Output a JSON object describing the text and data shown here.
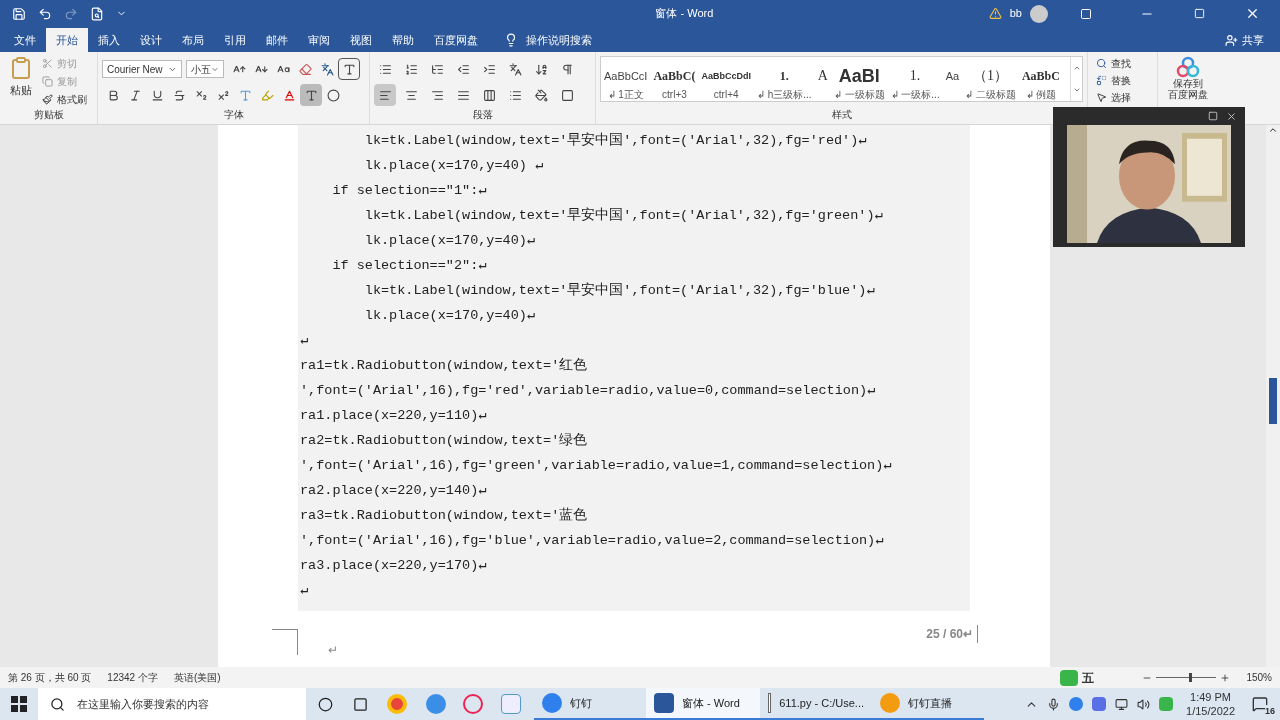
{
  "title_bar": {
    "title": "窗体  -  Word",
    "user": "bb"
  },
  "tabs": [
    {
      "label": "文件",
      "selected": false
    },
    {
      "label": "开始",
      "selected": true
    },
    {
      "label": "插入",
      "selected": false
    },
    {
      "label": "设计",
      "selected": false
    },
    {
      "label": "布局",
      "selected": false
    },
    {
      "label": "引用",
      "selected": false
    },
    {
      "label": "邮件",
      "selected": false
    },
    {
      "label": "审阅",
      "selected": false
    },
    {
      "label": "视图",
      "selected": false
    },
    {
      "label": "帮助",
      "selected": false
    },
    {
      "label": "百度网盘",
      "selected": false
    }
  ],
  "tell_me": "操作说明搜索",
  "share": "共享",
  "ribbon": {
    "clipboard": {
      "paste": "粘贴",
      "cut": "剪切",
      "copy": "复制",
      "format_painter": "格式刷",
      "label": "剪贴板"
    },
    "font": {
      "name": "Courier New",
      "size": "小五",
      "label": "字体"
    },
    "paragraph": {
      "label": "段落"
    },
    "styles": {
      "label": "样式",
      "items": [
        {
          "preview": "AaBbCcI",
          "name": "↲ 1正文",
          "kind": "plain"
        },
        {
          "preview": "AaBbC(",
          "name": "ctrl+3",
          "kind": "bold"
        },
        {
          "preview": "AaBbCcDdI",
          "name": "ctrl+4",
          "kind": "small"
        },
        {
          "preview": "1.",
          "name": "↲ h三级标...",
          "kind": "bold"
        },
        {
          "preview": "A",
          "kind": "serif"
        },
        {
          "preview": "AaBl",
          "name": "↲ 一级标题",
          "kind": "large"
        },
        {
          "preview": "1.",
          "name": "↲ 一级标...",
          "kind": "serif"
        },
        {
          "preview": "Aa",
          "kind": "plain"
        },
        {
          "preview": "（1）",
          "name": "↲ 二级标题",
          "kind": "serif"
        },
        {
          "preview": "AaBbC",
          "name": "↲ 例题",
          "kind": "bold"
        }
      ]
    },
    "editing": {
      "find": "查找",
      "replace": "替换",
      "select": "选择"
    },
    "baidu": {
      "line1": "保存到",
      "line2": "百度网盘"
    }
  },
  "document": {
    "code_lines": [
      "        lk=tk.Label(window,text='早安中国',font=('Arial',32),fg='red')↵",
      "        lk.place(x=170,y=40) ↵",
      "    if selection==\"1\":↵",
      "        lk=tk.Label(window,text='早安中国',font=('Arial',32),fg='green')↵",
      "        lk.place(x=170,y=40)↵",
      "    if selection==\"2\":↵",
      "        lk=tk.Label(window,text='早安中国',font=('Arial',32),fg='blue')↵",
      "        lk.place(x=170,y=40)↵",
      "↵",
      "ra1=tk.Radiobutton(window,text='红色",
      "',font=('Arial',16),fg='red',variable=radio,value=0,command=selection)↵",
      "ra1.place(x=220,y=110)↵",
      "ra2=tk.Radiobutton(window,text='绿色",
      "',font=('Arial',16),fg='green',variable=radio,value=1,command=selection)↵",
      "ra2.place(x=220,y=140)↵",
      "ra3=tk.Radiobutton(window,text='蓝色",
      "',font=('Arial',16),fg='blue',variable=radio,value=2,command=selection)↵",
      "ra3.place(x=220,y=170)↵",
      "↵"
    ],
    "page_number": "25 / 60↵",
    "end_mark": "↵"
  },
  "status_bar": {
    "page": "第 26 页，共 60 页",
    "words": "12342 个字",
    "language": "英语(美国)",
    "ime": "五",
    "zoom": "150%",
    "zoom_slider": {
      "level": 0.55
    }
  },
  "taskbar": {
    "search_placeholder": "在这里输入你要搜索的内容",
    "apps": [
      {
        "label": "钉钉",
        "kind": "dingtalk",
        "selected": false
      },
      {
        "label": "窗体 - Word",
        "kind": "word",
        "selected": true
      },
      {
        "label": "611.py - C:/Use...",
        "kind": "python",
        "selected": false
      },
      {
        "label": "钉钉直播",
        "kind": "live",
        "selected": false
      }
    ],
    "time": "1:49 PM",
    "date": "1/15/2022",
    "notifications": "16"
  }
}
